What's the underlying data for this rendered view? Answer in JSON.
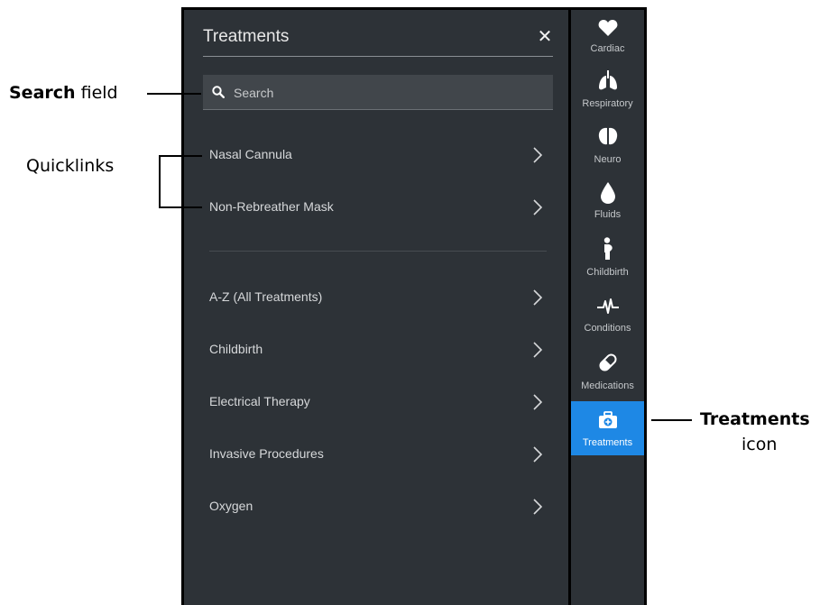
{
  "panel": {
    "title": "Treatments",
    "close_symbol": "✕",
    "search": {
      "placeholder": "Search",
      "value": ""
    },
    "quicklinks": [
      {
        "label": "Nasal Cannula"
      },
      {
        "label": "Non-Rebreather Mask"
      }
    ],
    "categories": [
      {
        "label": "A-Z (All Treatments)"
      },
      {
        "label": "Childbirth"
      },
      {
        "label": "Electrical Therapy"
      },
      {
        "label": "Invasive Procedures"
      },
      {
        "label": "Oxygen"
      }
    ]
  },
  "sidebar": {
    "items": [
      {
        "label": "Cardiac",
        "icon": "heart-icon"
      },
      {
        "label": "Respiratory",
        "icon": "lungs-icon"
      },
      {
        "label": "Neuro",
        "icon": "brain-icon"
      },
      {
        "label": "Fluids",
        "icon": "droplet-icon"
      },
      {
        "label": "Childbirth",
        "icon": "pregnant-person-icon"
      },
      {
        "label": "Conditions",
        "icon": "heartbeat-icon"
      },
      {
        "label": "Medications",
        "icon": "pill-icon"
      },
      {
        "label": "Treatments",
        "icon": "medical-kit-icon",
        "active": true
      }
    ],
    "active_color": "#1e88e5"
  },
  "callouts": {
    "search_bold": "Search",
    "search_rest": "field",
    "quicklinks": "Quicklinks",
    "treatments_bold": "Treatments",
    "treatments_rest": "icon"
  },
  "colors": {
    "panel_bg": "#2d3237",
    "text": "#d6d8da"
  }
}
